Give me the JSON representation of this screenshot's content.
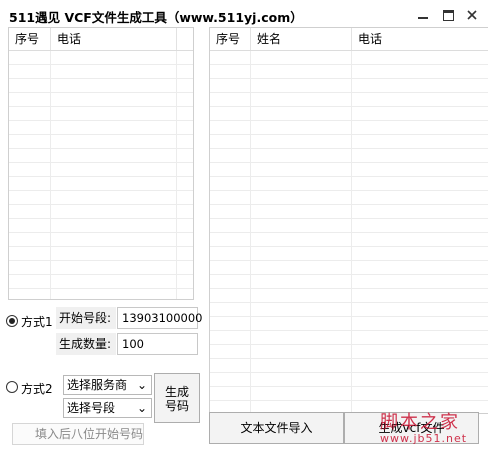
{
  "window": {
    "title": "511遇见 VCF文件生成工具（www.511yj.com）",
    "controls": [
      "minimize",
      "maximize",
      "close"
    ]
  },
  "left_table": {
    "columns": [
      "序号",
      "电话"
    ]
  },
  "right_table": {
    "columns": [
      "序号",
      "姓名",
      "电话"
    ]
  },
  "mode1": {
    "radio_label": "方式1",
    "selected": true,
    "start_label": "开始号段:",
    "start_value": "13903100000",
    "count_label": "生成数量:",
    "count_value": "100"
  },
  "mode2": {
    "radio_label": "方式2",
    "selected": false,
    "provider_select": "选择服务商",
    "segment_select": "选择号段",
    "suffix_placeholder": "填入后八位开始号码"
  },
  "buttons": {
    "generate": "生成号码",
    "import_text": "文本文件导入",
    "generate_vcf": "生成vcf文件"
  },
  "watermark": {
    "title": "脚本之家",
    "url": "www.jb51.net"
  }
}
